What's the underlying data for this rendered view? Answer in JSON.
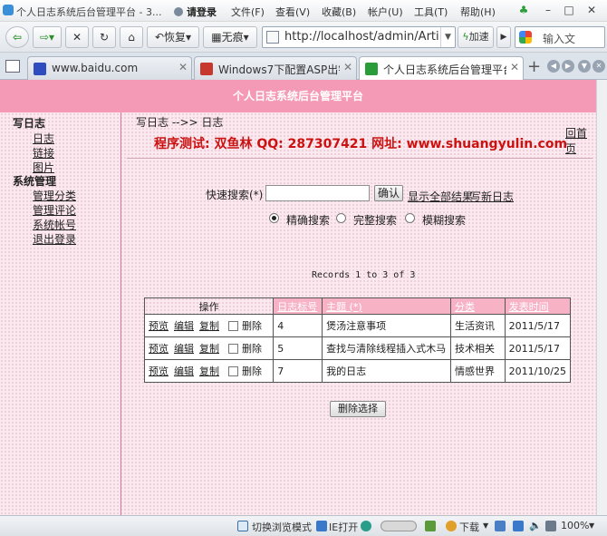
{
  "browser": {
    "window_title": "个人日志系统后台管理平台 - 3...",
    "login": "请登录",
    "menus": [
      "文件(F)",
      "查看(V)",
      "收藏(B)",
      "帐户(U)",
      "工具(T)",
      "帮助(H)"
    ],
    "restore_label": "恢复",
    "notrace_label": "无痕",
    "url": "http://localhost/admin/Arti",
    "accelerate_label": "加速",
    "search_placeholder": "输入文",
    "tabs": [
      {
        "label": "www.baidu.com",
        "favicon": "baidu-icon"
      },
      {
        "label": "Windows7下配置ASP出错...",
        "favicon": "page-red-icon"
      },
      {
        "label": "个人日志系统后台管理平台",
        "favicon": "page-refresh-icon"
      }
    ],
    "notification_count": "5",
    "status": {
      "mode": "切换浏览模式",
      "ie_open": "IE打开",
      "download": "下载",
      "zoom": "100%"
    }
  },
  "page": {
    "header_title": "个人日志系统后台管理平台",
    "sidebar": [
      {
        "label": "写日志",
        "type": "group"
      },
      {
        "label": "日志",
        "type": "link"
      },
      {
        "label": "链接",
        "type": "link"
      },
      {
        "label": "图片",
        "type": "link"
      },
      {
        "label": "系统管理",
        "type": "group"
      },
      {
        "label": "管理分类",
        "type": "link"
      },
      {
        "label": "管理评论",
        "type": "link"
      },
      {
        "label": "系统帐号",
        "type": "link"
      },
      {
        "label": "退出登录",
        "type": "link"
      }
    ],
    "breadcrumb": "写日志 -->> 日志",
    "promo_text": "程序测试: 双鱼林 QQ: 287307421 网址: www.shuangyulin.com",
    "home_link": "回首页",
    "search": {
      "label": "快速搜索(*)",
      "value": "",
      "button": "确认",
      "show_all": "显示全部结果",
      "write_new": "写新日志",
      "modes": [
        {
          "label": "精确搜索",
          "selected": true
        },
        {
          "label": "完整搜索",
          "selected": false
        },
        {
          "label": "模糊搜索",
          "selected": false
        }
      ]
    },
    "records_text": "Records 1 to 3 of 3",
    "table": {
      "headers": [
        "操作",
        "日志标号",
        "主题 (*)",
        "分类",
        "发表时间"
      ],
      "action_labels": [
        "预览",
        "编辑",
        "复制",
        "删除"
      ],
      "rows": [
        {
          "id": "4",
          "subject": "煲汤注意事项",
          "category": "生活资讯",
          "date": "2011/5/17"
        },
        {
          "id": "5",
          "subject": "查找与清除线程插入式木马",
          "category": "技术相关",
          "date": "2011/5/17"
        },
        {
          "id": "7",
          "subject": "我的日志",
          "category": "情感世界",
          "date": "2011/10/25"
        }
      ]
    },
    "delete_selected": "删除选择"
  }
}
